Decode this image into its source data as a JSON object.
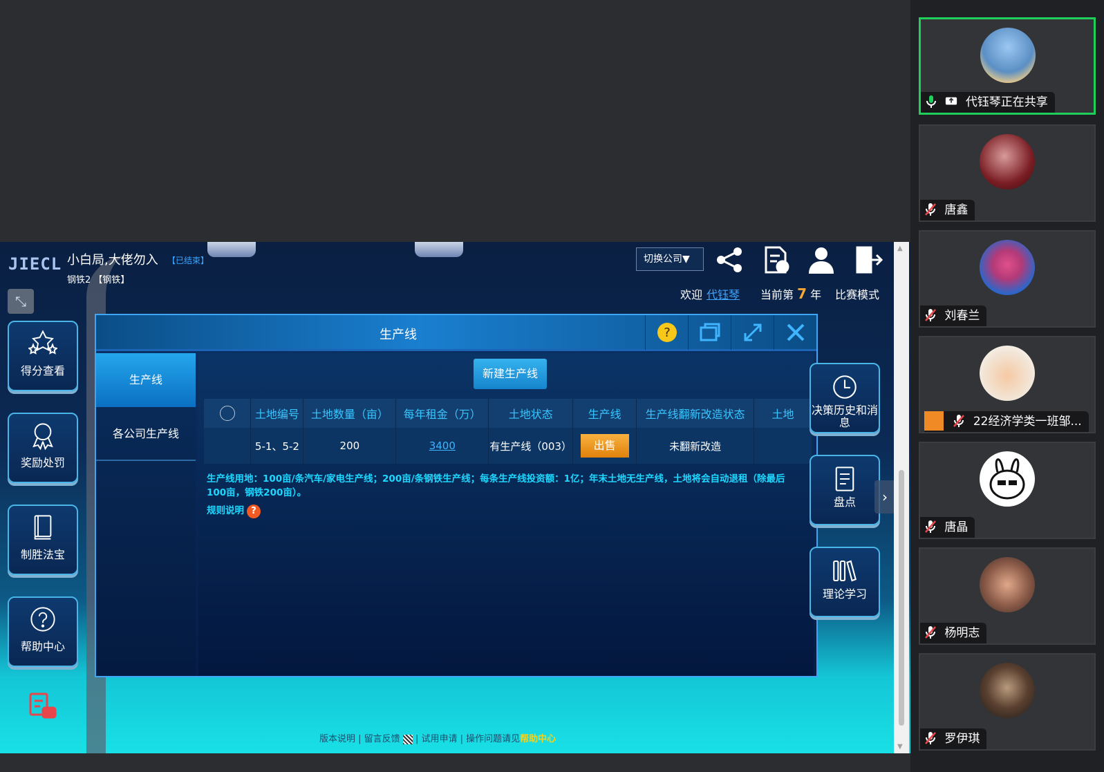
{
  "game": {
    "logo": "JIECL",
    "title": "小白局,大佬勿入",
    "status": "【已结束】",
    "subtitle": "钢铁2 【钢铁】",
    "switch_company": "切换公司▼",
    "welcome_prefix": "欢迎",
    "user_name": "代钰琴",
    "year_prefix": "当前第",
    "year_number": "7",
    "year_suffix": "年",
    "mode_label": "比赛模式"
  },
  "left_menu": [
    {
      "label": "得分查看",
      "icon": "stars-icon"
    },
    {
      "label": "奖励处罚",
      "icon": "award-icon"
    },
    {
      "label": "制胜法宝",
      "icon": "book-icon"
    },
    {
      "label": "帮助中心",
      "icon": "help-icon"
    }
  ],
  "right_menu": [
    {
      "label": "决策历史和消息",
      "icon": "history-icon"
    },
    {
      "label": "盘点",
      "icon": "document-icon"
    },
    {
      "label": "理论学习",
      "icon": "library-icon"
    }
  ],
  "modal": {
    "title": "生产线",
    "nav": [
      "生产线",
      "各公司生产线"
    ],
    "new_button": "新建生产线",
    "columns": [
      "",
      "土地编号",
      "土地数量（亩）",
      "每年租金（万）",
      "土地状态",
      "生产线",
      "生产线翻新改造状态",
      "土地"
    ],
    "row": {
      "land_id": "5-1、5-2",
      "land_area": "200",
      "annual_rent": "3400",
      "land_status": "有生产线（003）",
      "sell_button": "出售",
      "renovation_status": "未翻新改造",
      "land": ""
    },
    "note": "生产线用地：100亩/条汽车/家电生产线；200亩/条钢铁生产线；每条生产线投资额：1亿；年末土地无生产线，土地将会自动退租（除最后100亩，钢铁200亩）。",
    "rules_label": "规则说明",
    "rules_icon": "?"
  },
  "footer": {
    "version": "版本说明",
    "feedback": "留言反馈",
    "trial": "试用申请",
    "help_prefix": "操作问题请见",
    "help_link": "帮助中心"
  },
  "participants": [
    {
      "name": "代钰琴正在共享",
      "sharing": true,
      "mic": "on"
    },
    {
      "name": "唐鑫",
      "mic": "muted"
    },
    {
      "name": "刘春兰",
      "mic": "muted"
    },
    {
      "name": "22经济学类一班邹...",
      "mic": "muted",
      "host_badge": true
    },
    {
      "name": "唐晶",
      "mic": "muted"
    },
    {
      "name": "杨明志",
      "mic": "muted"
    },
    {
      "name": "罗伊琪",
      "mic": "muted"
    }
  ],
  "colors": {
    "accent": "#1ed7ff",
    "sell": "#f0970f",
    "active_speaker": "#1fcf5b"
  }
}
